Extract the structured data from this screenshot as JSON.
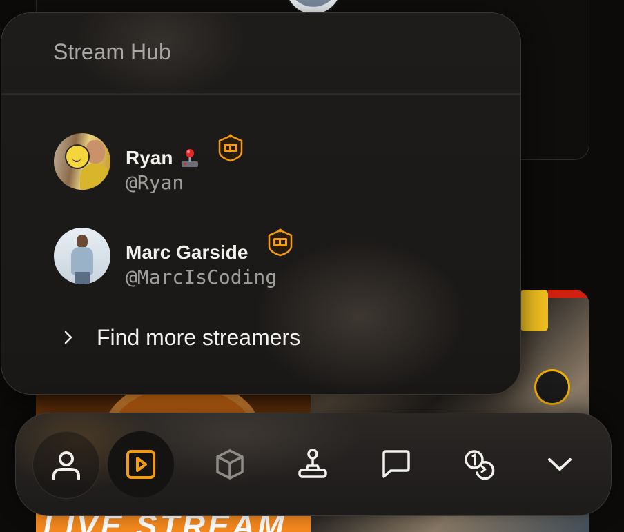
{
  "panel": {
    "title": "Stream Hub",
    "streamers": [
      {
        "name": "Ryan",
        "emoji_icon": "joystick-emoji",
        "handle": "@Ryan",
        "badge_icon": "mc-badge-icon"
      },
      {
        "name": "Marc Garside",
        "handle": "@MarcIsCoding",
        "badge_icon": "mc-badge-icon"
      }
    ],
    "find_more_label": "Find more streamers"
  },
  "background": {
    "thumbnail_text": "LIVE STREAM"
  },
  "nav": {
    "items": [
      {
        "icon": "user-icon",
        "active": false
      },
      {
        "icon": "play-icon",
        "active": true
      },
      {
        "icon": "cube-icon",
        "active": false
      },
      {
        "icon": "joystick-icon",
        "active": false
      },
      {
        "icon": "chat-icon",
        "active": false
      },
      {
        "icon": "coins-icon",
        "active": false
      },
      {
        "icon": "chevron-down-icon",
        "active": false
      }
    ]
  },
  "colors": {
    "accent": "#f39c12",
    "text_primary": "#f3f1ee",
    "text_muted": "#a09e9b",
    "icon_inactive": "#8f8b87"
  }
}
